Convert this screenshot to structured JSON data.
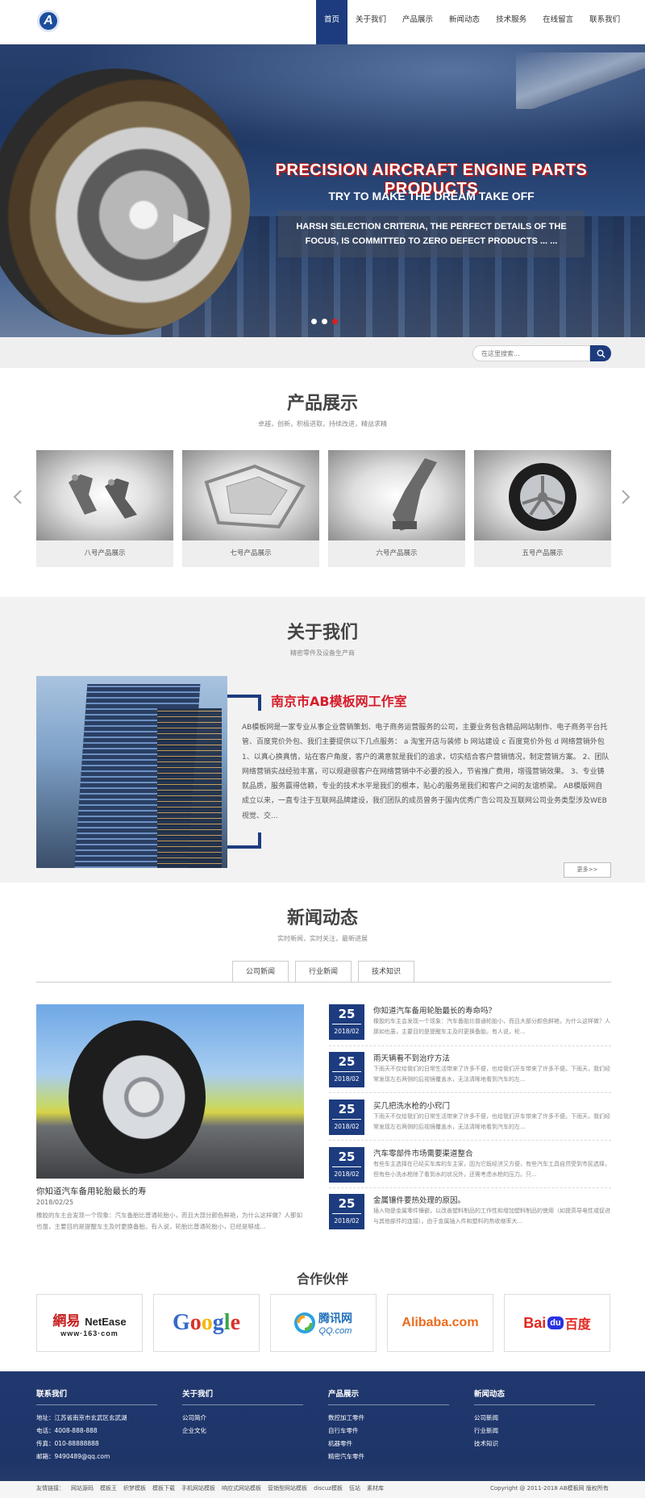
{
  "header": {
    "logo_letter": "A",
    "nav": [
      "首页",
      "关于我们",
      "产品展示",
      "新闻动态",
      "技术服务",
      "在线留言",
      "联系我们"
    ]
  },
  "banner": {
    "title": "PRECISION AIRCRAFT ENGINE PARTS PRODUCTS",
    "subtitle": "TRY TO MAKE THE DREAM TAKE OFF",
    "box_line1": "HARSH SELECTION CRITERIA, THE PERFECT DETAILS OF THE",
    "box_line2": "FOCUS, IS COMMITTED TO ZERO DEFECT PRODUCTS ... ...",
    "active_slide": 3,
    "slide_count": 3
  },
  "search": {
    "placeholder": "在这里搜索..."
  },
  "products": {
    "title": "产品展示",
    "subtitle": "卓越，创新，积极进取，持续改进，精益求精",
    "items": [
      "八号产品展示",
      "七号产品展示",
      "六号产品展示",
      "五号产品展示"
    ]
  },
  "about": {
    "title": "关于我们",
    "subtitle": "精密零件及设备生产商",
    "heading": "南京市AB模板网工作室",
    "text": "AB模板网是一家专业从事企业营销策划、电子商务运营服务的公司，主要业务包含精品网站制作、电子商务平台托管、百度竞价外包、我们主要提供以下几点服务： a 淘宝开店与装修 b 网站建设 c 百度竞价外包 d 网络营销外包 1、以真心换真情，站在客户角度，客户的满意就是我们的追求，切实结合客户营销情况，制定营销方案。 2、团队网络营销实战经验丰富，可以规避很客户在网络营销中不必要的投入，节省推广费用，增强营销效果。 3、专业铸就品质，服务赢得信赖，专业的技术水平是我们的根本，贴心的服务是我们和客户之间的友谊桥梁。 AB模版网自成立以来，一直专注于互联网品牌建设，我们团队的成员曾务于国内优秀广告公司及互联网公司业务类型涉及WEB视觉、交...",
    "more": "更多>>"
  },
  "news": {
    "title": "新闻动态",
    "subtitle": "实时新闻，实时关注，最新进展",
    "tabs": [
      "公司新闻",
      "行业新闻",
      "技术知识"
    ],
    "feature": {
      "title": "你知道汽车备用轮胎最长的寿",
      "date": "2018/02/25",
      "text": "橡胶的车主会发现一个现象：汽车备胎比普通轮胎小，而且大部分颜色鲜艳，为什么这样做？人那如也虽，主要目的是提醒车主及时更换备胎。有人说，轮胎比普通轮胎小，已经是够成..."
    },
    "items": [
      {
        "day": "25",
        "ym": "2018/02",
        "title": "你知道汽车备用轮胎最长的寿命吗？",
        "desc": "橡胶的车主会发现一个现象：汽车备胎比普通轮胎小，而且大部分颜色鲜艳，为什么这样做？人那如也虽，主要目的是提醒车主及时更换备胎。有人说，轮..."
      },
      {
        "day": "25",
        "ym": "2018/02",
        "title": "雨天辆看不到治疗方法",
        "desc": "下雨天不仅给我们的日常生活带来了许多不便，也给我们开车带来了许多不便。下雨天，我们经常发现左右两侧的后视镜覆盖水，无法清晰地看到汽车的左..."
      },
      {
        "day": "25",
        "ym": "2018/02",
        "title": "买几把洗水枪的小窍门",
        "desc": "下雨天不仅给我们的日常生活带来了许多不便，也给我们开车带来了许多不便。下雨天，我们经常发现左右两侧的后视镜覆盖水，无法清晰地看到汽车的左..."
      },
      {
        "day": "25",
        "ym": "2018/02",
        "title": "汽车零部件市场需要渠道整合",
        "desc": "有些车主选择在已经买车库的车主家，因为它既经济又方便，有些汽车工具自然受到市民选择，但有些小洗水枪除了看到水的状况外，还需考虑水枪的压力。只..."
      },
      {
        "day": "25",
        "ym": "2018/02",
        "title": "金属镶件要热处理的原因。",
        "desc": "插入物是金属零件镶嵌，以改善塑料制品的工作性和增加塑料制品的使用（如提高导电性或促进与其他部件的连接）。由于金属插入件和塑料的热收缩率大..."
      }
    ]
  },
  "partners": {
    "title": "合作伙伴",
    "logos": [
      "NetEase",
      "Google",
      "Tencent",
      "Alibaba",
      "Baidu"
    ],
    "netease_cn": "網易",
    "netease_en": "NetEase",
    "netease_url": "www·163·com",
    "google": "Google",
    "qq_cn": "腾讯网",
    "qq_url": "QQ.com",
    "alibaba": "Alibaba.com",
    "baidu_en": "Bai",
    "baidu_du": "du",
    "baidu_cn": "百度"
  },
  "footer": {
    "contact": {
      "title": "联系我们",
      "lines": [
        "地址：江苏省南京市玄武区玄武湖",
        "电话：4008-888-888",
        "传真：010-88888888",
        "邮箱：9490489@qq.com"
      ]
    },
    "about": {
      "title": "关于我们",
      "lines": [
        "公司简介",
        "企业文化"
      ]
    },
    "products": {
      "title": "产品展示",
      "lines": [
        "数控加工零件",
        "自行车零件",
        "机器零件",
        "精密汽车零件"
      ]
    },
    "news": {
      "title": "新闻动态",
      "lines": [
        "公司新闻",
        "行业新闻",
        "技术知识"
      ]
    },
    "links_label": "友情链接：",
    "links": [
      "网站源码",
      "模板王",
      "织梦模板",
      "模板下载",
      "手机网站模板",
      "响应式网站模板",
      "营销型网站模板",
      "discuz模板",
      "伍站",
      "素材库"
    ],
    "copyright": "Copyright @ 2011-2018 AB模板网 版权所有"
  },
  "colors": {
    "brand": "#1d3c7f",
    "accent": "#d61c2a"
  }
}
